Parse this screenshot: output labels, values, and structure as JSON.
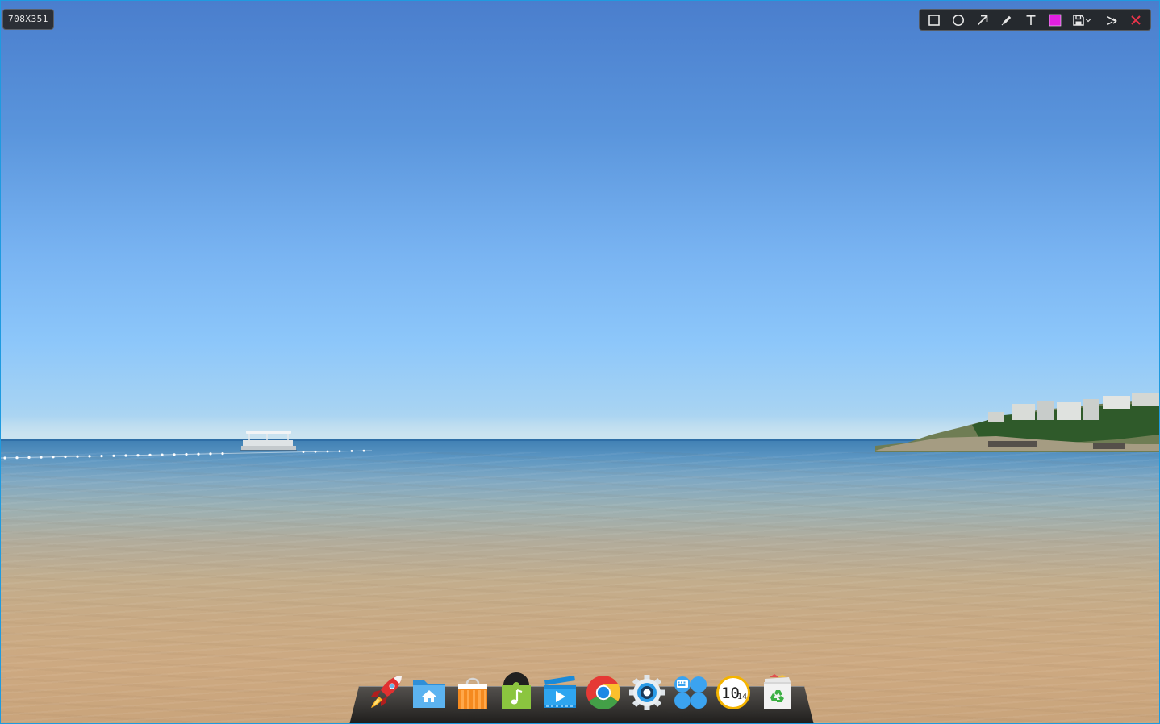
{
  "selection": {
    "size_label": "708X351"
  },
  "toolbar": {
    "tools": [
      {
        "name": "rectangle",
        "icon": "rectangle-icon"
      },
      {
        "name": "ellipse",
        "icon": "ellipse-icon"
      },
      {
        "name": "arrow",
        "icon": "arrow-icon"
      },
      {
        "name": "pencil",
        "icon": "pencil-icon"
      },
      {
        "name": "text",
        "icon": "text-icon"
      },
      {
        "name": "color",
        "icon": "color-swatch",
        "color": "#e020e0"
      },
      {
        "name": "save",
        "icon": "save-icon"
      },
      {
        "name": "share",
        "icon": "share-icon"
      },
      {
        "name": "close",
        "icon": "close-icon",
        "color": "#e8334a"
      }
    ]
  },
  "dock": {
    "items": [
      {
        "name": "launcher",
        "icon": "rocket-icon"
      },
      {
        "name": "file-manager",
        "icon": "home-folder-icon"
      },
      {
        "name": "store",
        "icon": "shopping-bag-icon"
      },
      {
        "name": "music",
        "icon": "music-note-icon"
      },
      {
        "name": "video",
        "icon": "film-player-icon"
      },
      {
        "name": "chrome",
        "icon": "chrome-icon"
      },
      {
        "name": "settings",
        "icon": "gear-icon"
      },
      {
        "name": "input-method",
        "icon": "keyboard-icon"
      },
      {
        "name": "clock",
        "icon": "clock-icon",
        "hour": "10",
        "minute": "14"
      },
      {
        "name": "trash",
        "icon": "recycle-bin-icon"
      }
    ]
  },
  "wallpaper": {
    "sky_color": "#5a95dc",
    "sea_color": "#5a95c2",
    "sand_color": "#c9aa84"
  }
}
